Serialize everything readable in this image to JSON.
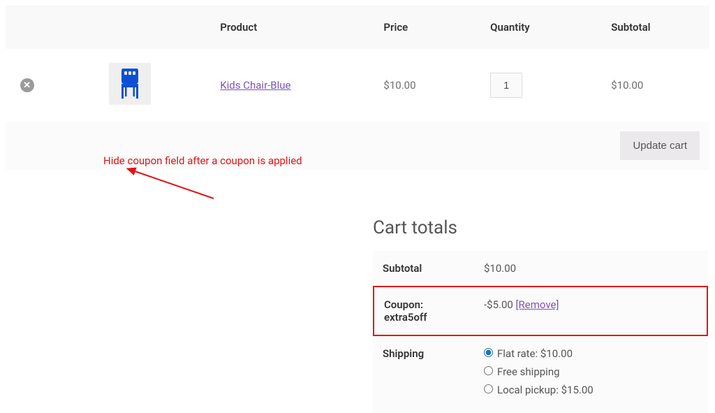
{
  "headers": {
    "product": "Product",
    "price": "Price",
    "quantity": "Quantity",
    "subtotal": "Subtotal"
  },
  "item": {
    "name": "Kids Chair-Blue",
    "price": "$10.00",
    "quantity": "1",
    "subtotal": "$10.00"
  },
  "actions": {
    "update_cart": "Update cart"
  },
  "annotation": "Hide coupon field after a coupon is applied",
  "totals": {
    "title": "Cart totals",
    "subtotal_label": "Subtotal",
    "subtotal_value": "$10.00",
    "coupon_label_prefix": "Coupon:",
    "coupon_code": "extra5off",
    "coupon_amount": "-$5.00 ",
    "coupon_remove": "[Remove]",
    "shipping_label": "Shipping",
    "shipping": [
      {
        "label": "Flat rate: $10.00",
        "checked": true
      },
      {
        "label": "Free shipping",
        "checked": false
      },
      {
        "label": "Local pickup: $15.00",
        "checked": false
      }
    ]
  }
}
